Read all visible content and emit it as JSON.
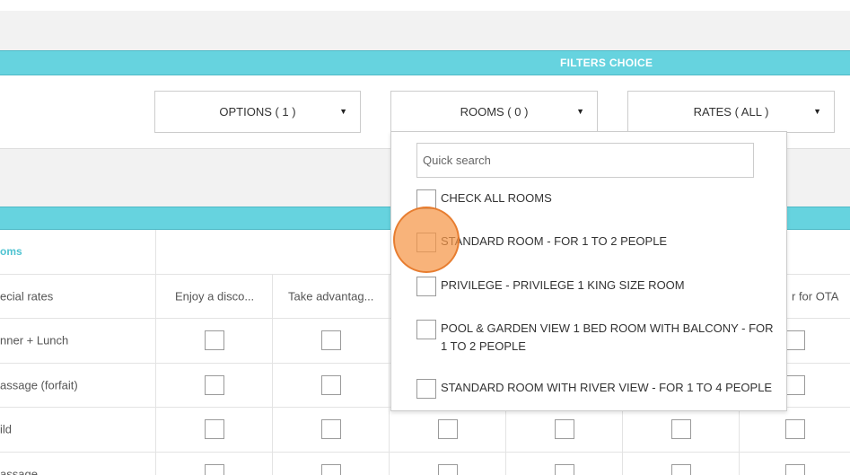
{
  "header": {
    "filters_label": "FILTERS CHOICE"
  },
  "filters": {
    "options_label": "OPTIONS ( 1 )",
    "rooms_label": "ROOMS ( 0 )",
    "rates_label": "RATES ( ALL )",
    "caret": "▼"
  },
  "rooms_dropdown": {
    "search_placeholder": "Quick search",
    "items": [
      {
        "label": "CHECK ALL ROOMS",
        "checked": false
      },
      {
        "label": "STANDARD ROOM - FOR 1 TO 2 PEOPLE",
        "checked": false
      },
      {
        "label": "PRIVILEGE - PRIVILEGE 1 KING SIZE ROOM",
        "checked": false
      },
      {
        "label": "POOL & GARDEN VIEW 1 BED ROOM WITH BALCONY - FOR 1 TO 2 PEOPLE",
        "checked": false
      },
      {
        "label": "STANDARD ROOM WITH RIVER VIEW - FOR 1 TO 4 PEOPLE",
        "checked": false
      }
    ]
  },
  "table": {
    "rooms_link": "oms",
    "header_row": {
      "first": "ecial rates",
      "col1": "Enjoy a disco...",
      "col2": "Take advantag...",
      "col_last": "r for OTA"
    },
    "rows": [
      {
        "label": "nner + Lunch"
      },
      {
        "label": "assage (forfait)"
      },
      {
        "label": "ild"
      },
      {
        "label": "assage"
      }
    ]
  },
  "cursor": {
    "color": "#f5964a"
  }
}
